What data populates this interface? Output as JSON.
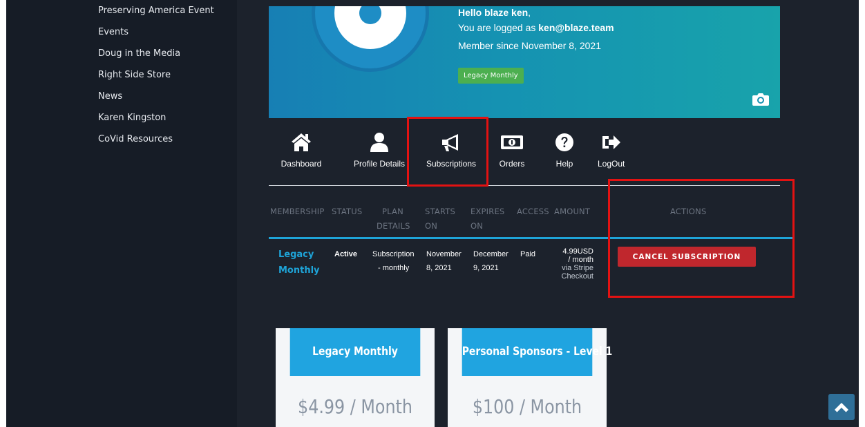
{
  "sidebar": {
    "items": [
      {
        "label": "Preserving America Event"
      },
      {
        "label": "Events"
      },
      {
        "label": "Doug in the Media"
      },
      {
        "label": "Right Side Store"
      },
      {
        "label": "News"
      },
      {
        "label": "Karen Kingston"
      },
      {
        "label": "CoVid Resources"
      }
    ]
  },
  "profile": {
    "hello_prefix": "Hello ",
    "name": "blaze ken",
    "hello_suffix": ",",
    "logged_prefix": "You are logged as ",
    "email": "ken@blaze.team",
    "member_since": "Member since November 8, 2021",
    "badge": "Legacy Monthly"
  },
  "tabs": [
    {
      "label": "Dashboard",
      "icon": "home-icon"
    },
    {
      "label": "Profile Details",
      "icon": "user-icon"
    },
    {
      "label": "Subscriptions",
      "icon": "megaphone-icon"
    },
    {
      "label": "Orders",
      "icon": "money-icon"
    },
    {
      "label": "Help",
      "icon": "question-icon"
    },
    {
      "label": "LogOut",
      "icon": "logout-icon"
    }
  ],
  "table": {
    "headers": {
      "membership": "MEMBERSHIP",
      "status": "STATUS",
      "plan_1": "PLAN",
      "plan_2": "DETAILS",
      "starts_1": "STARTS",
      "starts_2": "ON",
      "expires_1": "EXPIRES",
      "expires_2": "ON",
      "access": "ACCESS",
      "amount": "AMOUNT",
      "actions": "ACTIONS"
    },
    "row": {
      "plan_1": "Legacy",
      "plan_2": "Monthly",
      "status": "Active",
      "details_1": "Subscription",
      "details_2": "- monthly",
      "starts_1": "November",
      "starts_2": "8, 2021",
      "expires_1": "December",
      "expires_2": "9, 2021",
      "access": "Paid",
      "amount_1": "4.99USD",
      "amount_2": "/ month",
      "amount_3": "via Stripe",
      "amount_4": "Checkout",
      "action": "CANCEL SUBSCRIPTION"
    }
  },
  "cards": [
    {
      "title": "Legacy Monthly",
      "price": "$4.99 / Month"
    },
    {
      "title": "Personal Sponsors - Level 1",
      "price": "$100 / Month"
    }
  ],
  "colors": {
    "accent": "#1ea4d8",
    "cancel": "#c0272d",
    "badge": "#4caf50",
    "highlight": "#e31212"
  }
}
